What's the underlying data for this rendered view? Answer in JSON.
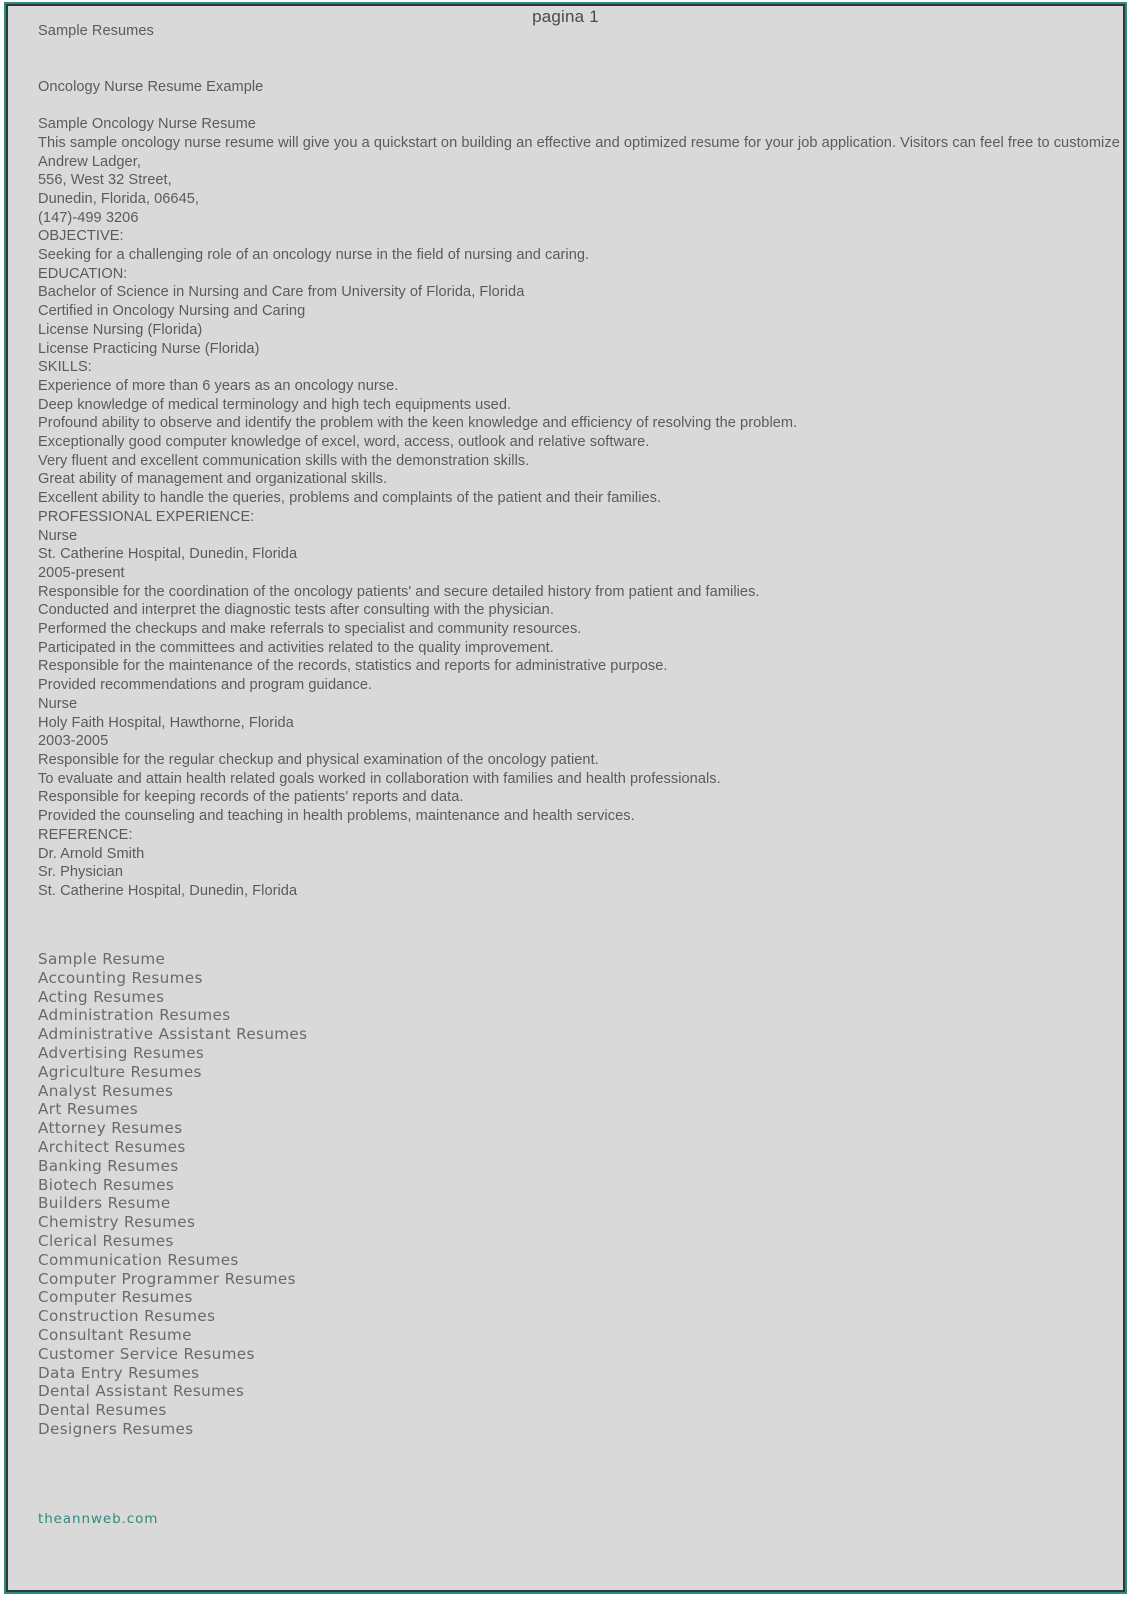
{
  "header": {
    "page_label": "pagina 1"
  },
  "document": {
    "site_title": "Sample Resumes",
    "page_title": "Oncology Nurse Resume Example",
    "resume_heading": "Sample Oncology Nurse Resume",
    "intro": "This sample oncology nurse resume will give you a quickstart on building an effective and optimized resume for your job application. Visitors can feel free to customize",
    "contact": {
      "name": "Andrew Ladger,",
      "street": "556, West 32 Street,",
      "city_state_zip": "Dunedin, Florida, 06645,",
      "phone": "(147)-499 3206"
    },
    "sections": [
      {
        "heading": "OBJECTIVE:",
        "lines": [
          "Seeking for a challenging role of an oncology nurse in the field of nursing and caring."
        ]
      },
      {
        "heading": "EDUCATION:",
        "lines": [
          "Bachelor of Science in Nursing and Care from University of Florida, Florida",
          "Certified in Oncology Nursing and Caring",
          "License Nursing (Florida)",
          "License Practicing Nurse (Florida)"
        ]
      },
      {
        "heading": "SKILLS:",
        "lines": [
          "Experience of more than 6 years as an oncology nurse.",
          "Deep knowledge of medical terminology and high tech equipments used.",
          "Profound ability to observe and identify the problem with the keen knowledge and efficiency of resolving the problem.",
          "Exceptionally good computer knowledge of excel, word, access, outlook and relative software.",
          "Very fluent and excellent communication skills with the demonstration skills.",
          "Great ability of management and organizational skills.",
          "Excellent ability to handle the queries, problems and complaints of the patient and their families."
        ]
      },
      {
        "heading": "PROFESSIONAL EXPERIENCE:",
        "lines": [
          "Nurse",
          "St. Catherine Hospital, Dunedin, Florida",
          "2005-present",
          "Responsible for the coordination of the oncology patients' and secure detailed history from patient and families.",
          "Conducted and interpret the diagnostic tests after consulting with the physician.",
          "Performed the checkups and make referrals to specialist and community resources.",
          "Participated in the committees and activities related to the quality improvement.",
          "Responsible for the maintenance of the records, statistics and reports for administrative purpose.",
          "Provided recommendations and program guidance.",
          "Nurse",
          "Holy Faith Hospital, Hawthorne, Florida",
          "2003-2005",
          "Responsible for the regular checkup and physical examination of the oncology patient.",
          "To evaluate and attain health related goals worked in collaboration with families and health professionals.",
          "Responsible for keeping records of the patients' reports and data.",
          "Provided the counseling and teaching in health problems, maintenance and health services."
        ]
      },
      {
        "heading": "REFERENCE:",
        "lines": [
          "Dr. Arnold Smith",
          "Sr. Physician",
          "St. Catherine Hospital, Dunedin, Florida"
        ]
      }
    ]
  },
  "categories": [
    "Sample Resume",
    "Accounting Resumes",
    "Acting Resumes",
    "Administration Resumes",
    "Administrative Assistant Resumes",
    "Advertising Resumes",
    "Agriculture Resumes",
    "Analyst Resumes",
    "Art Resumes",
    "Attorney Resumes",
    "Architect Resumes",
    "Banking Resumes",
    "Biotech Resumes",
    "Builders Resume",
    "Chemistry Resumes",
    "Clerical Resumes",
    "Communication Resumes",
    "Computer Programmer Resumes",
    "Computer Resumes",
    "Construction Resumes",
    "Consultant Resume",
    "Customer Service Resumes",
    "Data Entry Resumes",
    "Dental Assistant Resumes",
    "Dental Resumes",
    "Designers Resumes"
  ],
  "footer": {
    "watermark": "theannweb.com"
  },
  "colors": {
    "page_background": "#d9d9d9",
    "body_text": "#5b5b5b",
    "category_text": "#6a6a6a",
    "border_outer": "#2f8a7d",
    "border_inner": "#2b3a38",
    "footer_accent": "#2f8a7d"
  }
}
